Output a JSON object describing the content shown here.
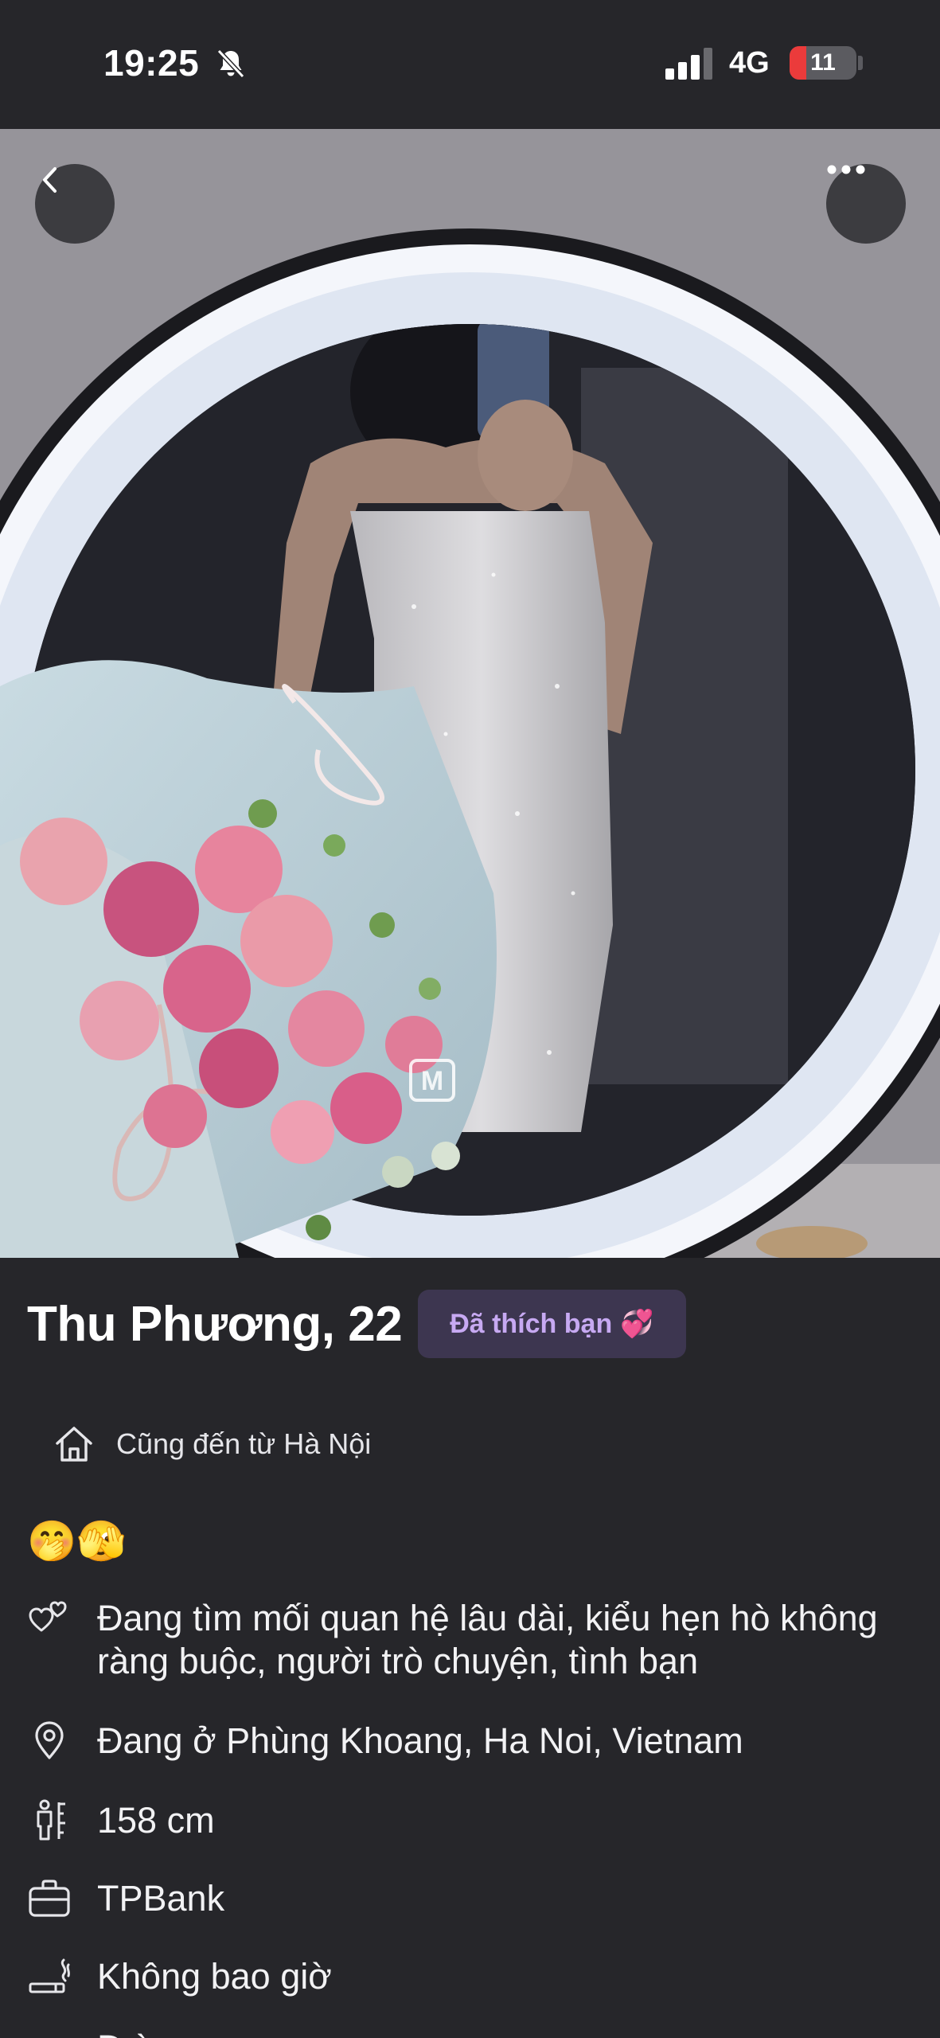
{
  "status_bar": {
    "time": "19:25",
    "network": "4G",
    "battery_level": "11",
    "battery_fraction": 0.11,
    "icons": [
      "bell-slash-icon",
      "cellular-signal-icon",
      "battery-icon"
    ]
  },
  "photo": {
    "watermark": "M"
  },
  "controls": {
    "back_icon": "chevron-left-icon",
    "more_icon": "ellipsis-icon"
  },
  "profile": {
    "name_age": "Thu Phương, 22",
    "liked_badge": "Đã thích bạn",
    "liked_badge_emoji": "💞",
    "hometown": "Cũng đến từ Hà Nội",
    "emojis": "🤭🫣",
    "looking_for": "Đang tìm mối quan hệ lâu dài, kiểu hẹn hò không ràng buộc, người trò chuyện, tình bạn",
    "location": "Đang ở Phùng Khoang, Ha Noi, Vietnam",
    "height": "158 cm",
    "work": "TPBank",
    "smoking": "Không bao giờ",
    "next_row_partial": "Đ  ờ"
  },
  "colors": {
    "background": "#26262a",
    "badge_background": "#3d3650",
    "badge_text": "#c7a9f2",
    "battery_low": "#eb3b3b"
  }
}
